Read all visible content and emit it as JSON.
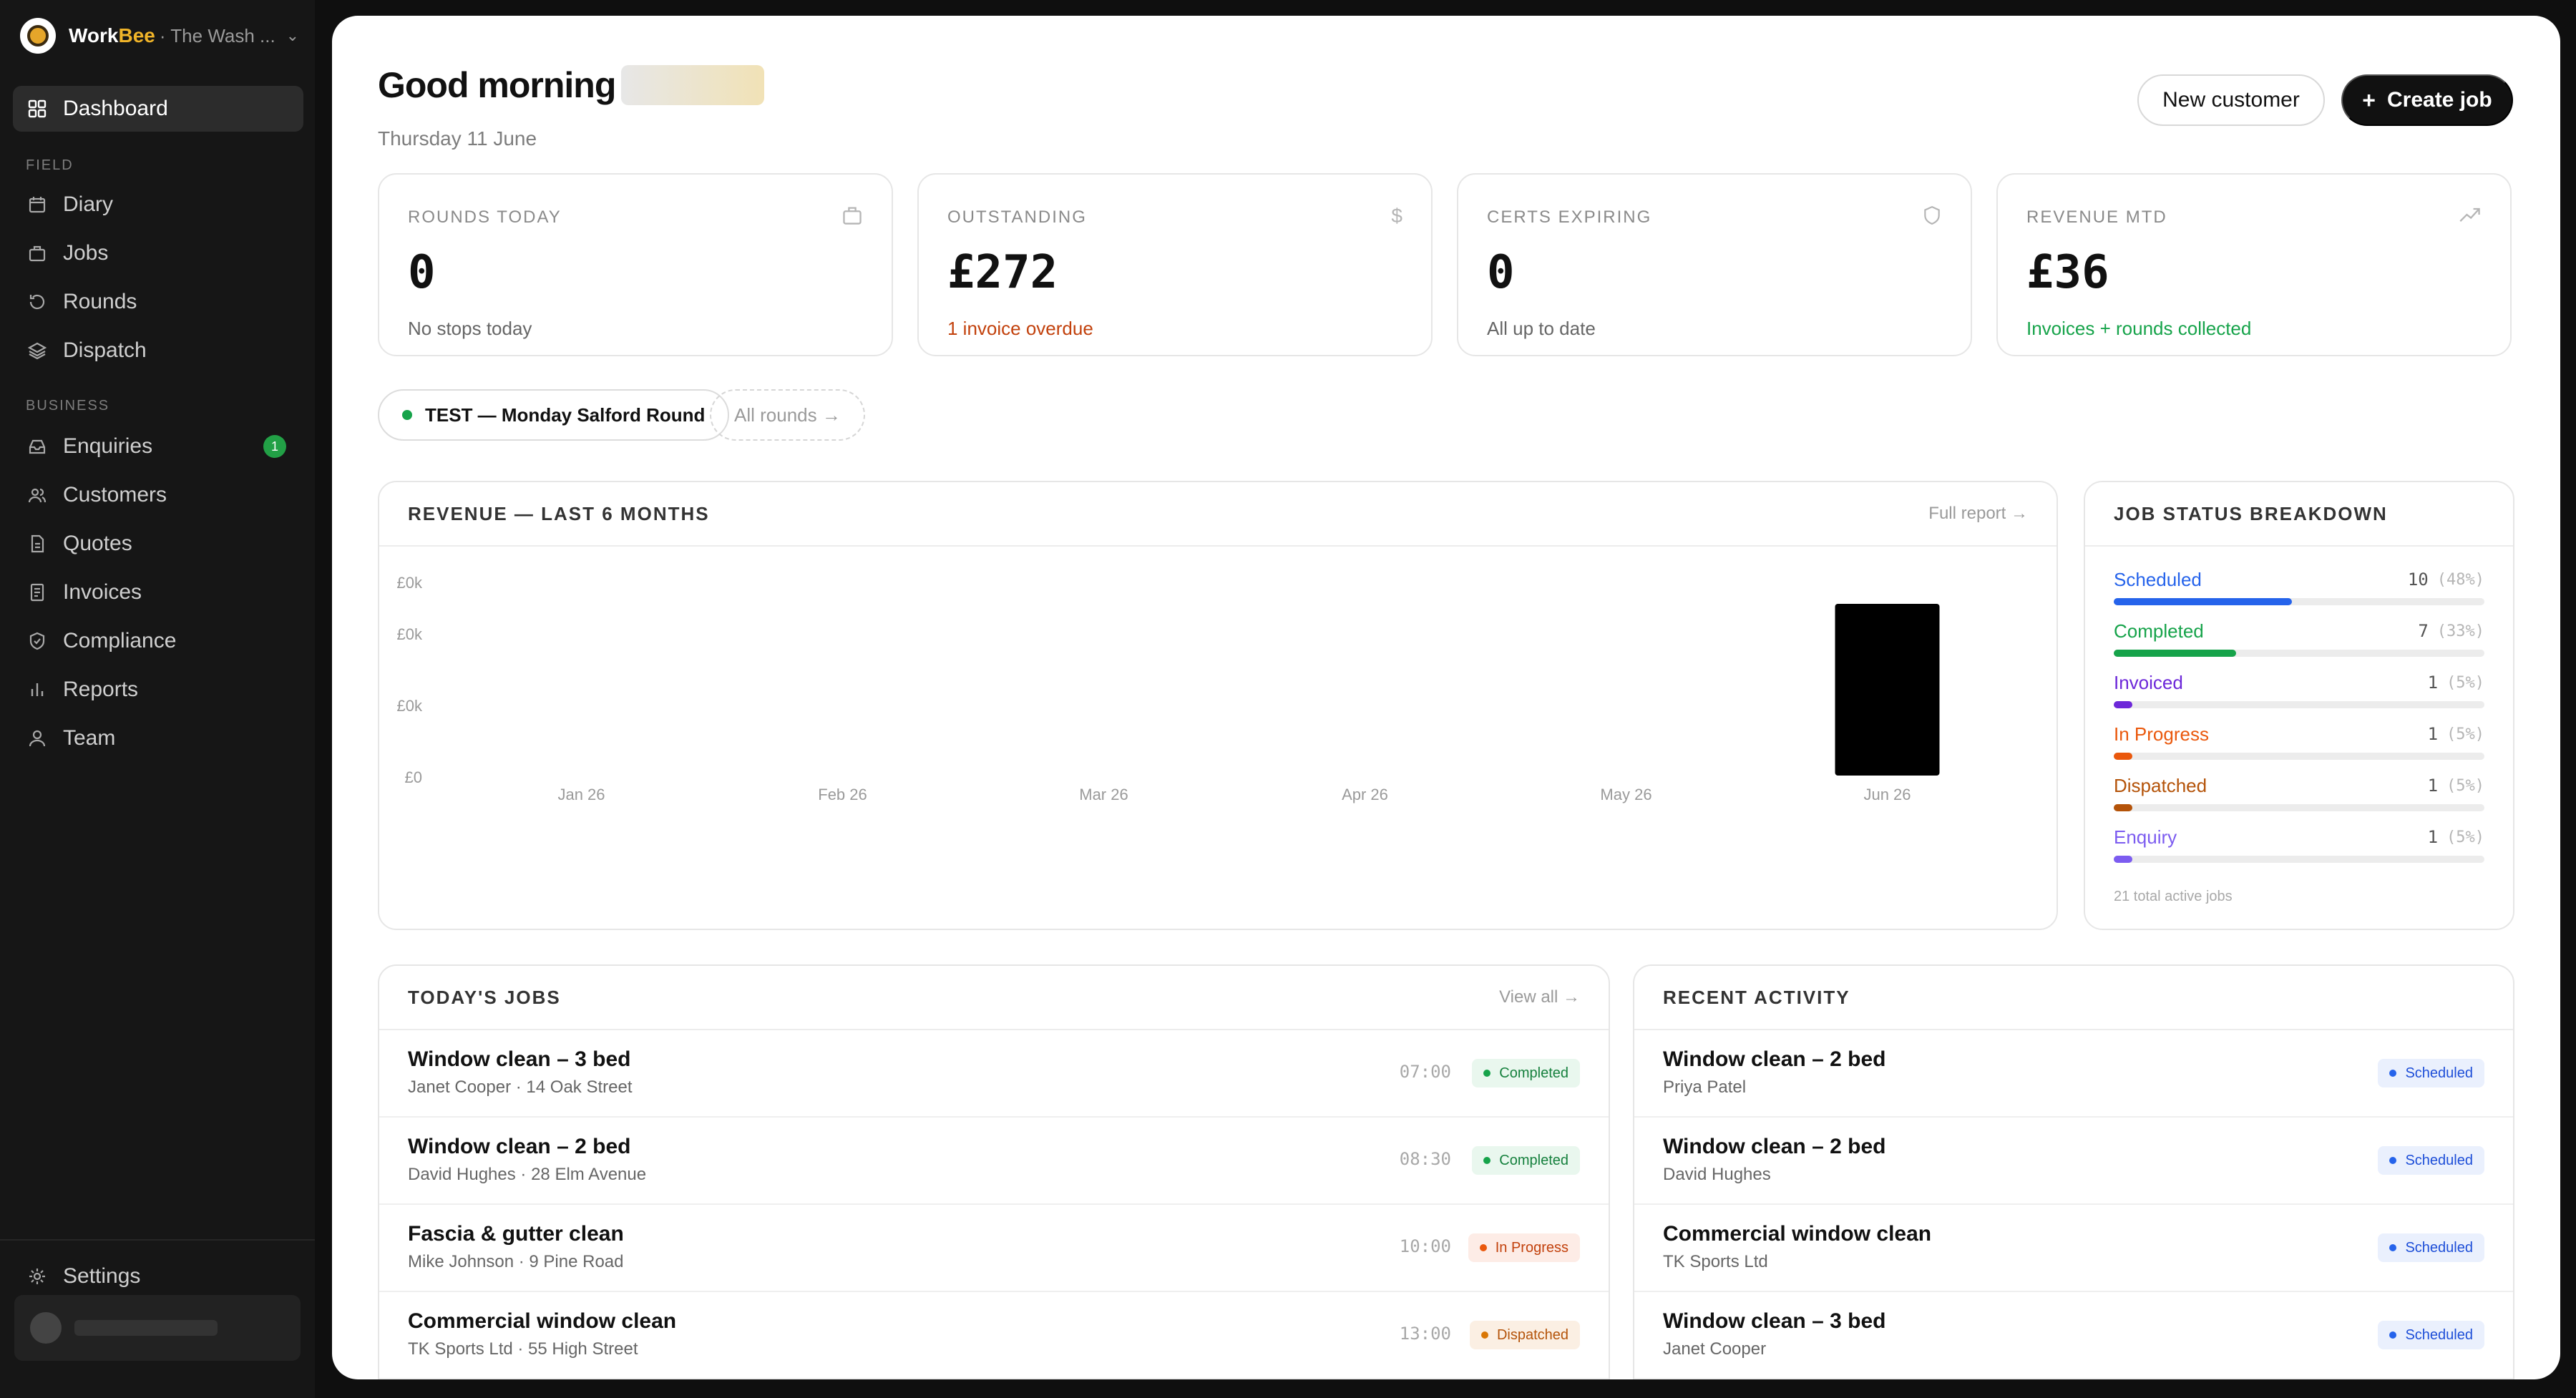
{
  "brand": {
    "name_prefix": "Work",
    "name_accent": "Bee",
    "org": "· The Wash ..."
  },
  "sidebar": {
    "nav": [
      {
        "label": "Dashboard",
        "icon": "grid-icon",
        "active": true
      }
    ],
    "section_field": "FIELD",
    "field_items": [
      {
        "label": "Diary",
        "icon": "calendar-icon"
      },
      {
        "label": "Jobs",
        "icon": "briefcase-icon"
      },
      {
        "label": "Rounds",
        "icon": "refresh-icon"
      },
      {
        "label": "Dispatch",
        "icon": "layers-icon"
      }
    ],
    "section_business": "BUSINESS",
    "business_items": [
      {
        "label": "Enquiries",
        "icon": "inbox-icon",
        "badge": "1"
      },
      {
        "label": "Customers",
        "icon": "users-icon"
      },
      {
        "label": "Quotes",
        "icon": "document-icon"
      },
      {
        "label": "Invoices",
        "icon": "receipt-icon"
      },
      {
        "label": "Compliance",
        "icon": "shield-icon"
      },
      {
        "label": "Reports",
        "icon": "bar-chart-icon"
      },
      {
        "label": "Team",
        "icon": "user-icon"
      }
    ],
    "settings_label": "Settings"
  },
  "header": {
    "greeting": "Good morning",
    "date": "Thursday 11 June",
    "new_customer": "New customer",
    "create_job_plus": "+",
    "create_job": "Create job"
  },
  "stats": [
    {
      "label": "ROUNDS TODAY",
      "value": "0",
      "sub": "No stops today",
      "icon": "briefcase-icon"
    },
    {
      "label": "OUTSTANDING",
      "value": "£272",
      "sub": "1 invoice overdue",
      "icon": "dollar-icon"
    },
    {
      "label": "CERTS EXPIRING",
      "value": "0",
      "sub": "All up to date",
      "icon": "shield-icon"
    },
    {
      "label": "REVENUE MTD",
      "value": "£36",
      "sub": "Invoices + rounds collected",
      "icon": "trend-up-icon"
    }
  ],
  "rounds": {
    "active": "TEST — Monday Salford Round",
    "all": "All rounds →"
  },
  "revenue": {
    "title": "REVENUE — LAST 6 MONTHS",
    "link": "Full report →"
  },
  "chart_data": {
    "type": "bar",
    "title": "REVENUE — LAST 6 MONTHS",
    "categories": [
      "Jan 26",
      "Feb 26",
      "Mar 26",
      "Apr 26",
      "May 26",
      "Jun 26"
    ],
    "values": [
      0,
      0,
      0,
      0,
      0,
      36
    ],
    "y_tick_labels": [
      "£0k",
      "£0k",
      "£0k",
      "£0"
    ],
    "ylim": [
      0,
      36
    ],
    "bar_color": "#000000",
    "grid": false
  },
  "status_breakdown": {
    "title": "JOB STATUS BREAKDOWN",
    "items": [
      {
        "name": "Scheduled",
        "count": "10",
        "pct": "(48%)",
        "fraction": 0.48,
        "color": "#2563eb"
      },
      {
        "name": "Completed",
        "count": "7",
        "pct": "(33%)",
        "fraction": 0.33,
        "color": "#16a34a"
      },
      {
        "name": "Invoiced",
        "count": "1",
        "pct": "(5%)",
        "fraction": 0.05,
        "color": "#6d28d9"
      },
      {
        "name": "In Progress",
        "count": "1",
        "pct": "(5%)",
        "fraction": 0.05,
        "color": "#ea580c"
      },
      {
        "name": "Dispatched",
        "count": "1",
        "pct": "(5%)",
        "fraction": 0.05,
        "color": "#b45309"
      },
      {
        "name": "Enquiry",
        "count": "1",
        "pct": "(5%)",
        "fraction": 0.05,
        "color": "#7c5cf0"
      }
    ],
    "total": "21 total active jobs"
  },
  "todays_jobs": {
    "title": "TODAY'S JOBS",
    "link": "View all →",
    "rows": [
      {
        "title": "Window clean – 3 bed",
        "sub": "Janet Cooper · 14 Oak Street",
        "time": "07:00",
        "status": "Completed",
        "kind": "completed"
      },
      {
        "title": "Window clean – 2 bed",
        "sub": "David Hughes · 28 Elm Avenue",
        "time": "08:30",
        "status": "Completed",
        "kind": "completed"
      },
      {
        "title": "Fascia & gutter clean",
        "sub": "Mike Johnson · 9 Pine Road",
        "time": "10:00",
        "status": "In Progress",
        "kind": "progress"
      },
      {
        "title": "Commercial window clean",
        "sub": "TK Sports Ltd · 55 High Street",
        "time": "13:00",
        "status": "Dispatched",
        "kind": "dispatched"
      }
    ]
  },
  "recent_activity": {
    "title": "RECENT ACTIVITY",
    "rows": [
      {
        "title": "Window clean – 2 bed",
        "sub": "Priya Patel",
        "status": "Scheduled",
        "kind": "scheduled"
      },
      {
        "title": "Window clean – 2 bed",
        "sub": "David Hughes",
        "status": "Scheduled",
        "kind": "scheduled"
      },
      {
        "title": "Commercial window clean",
        "sub": "TK Sports Ltd",
        "status": "Scheduled",
        "kind": "scheduled"
      },
      {
        "title": "Window clean – 3 bed",
        "sub": "Janet Cooper",
        "status": "Scheduled",
        "kind": "scheduled"
      }
    ]
  }
}
